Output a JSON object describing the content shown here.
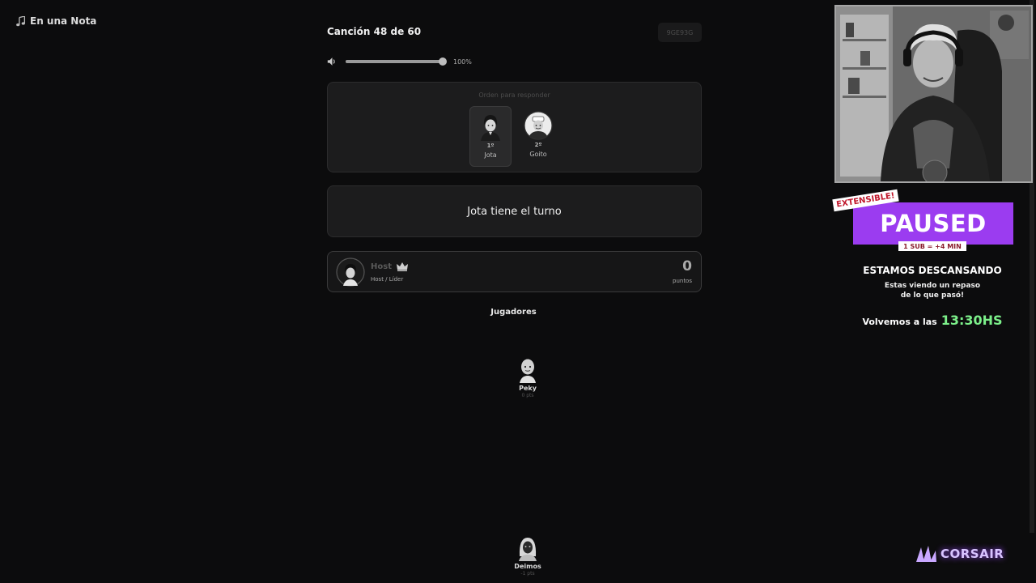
{
  "app": {
    "title": "En una Nota"
  },
  "game": {
    "song_counter": "Canción 48 de 60",
    "room_code": "9GE93G",
    "volume": {
      "percent": 100,
      "label": "100%"
    }
  },
  "order": {
    "title": "Orden para responder",
    "players": [
      {
        "position": "1º",
        "name": "Jota",
        "active": true,
        "avatar": "woman-avatar-icon"
      },
      {
        "position": "2º",
        "name": "Goito",
        "active": false,
        "avatar": "chef-avatar-icon"
      }
    ]
  },
  "turn": {
    "text": "Jota tiene el turno"
  },
  "host": {
    "name": "Host",
    "role": "Host / Líder",
    "score": "0",
    "score_label": "puntos",
    "icon": "crown-icon"
  },
  "players_section": {
    "label": "Jugadores",
    "players": [
      {
        "name": "Peky",
        "points": "0 pts",
        "avatar": "bald-avatar-icon"
      },
      {
        "name": "Deimos",
        "points": "-1 pts",
        "avatar": "hooded-avatar-icon"
      }
    ]
  },
  "stream_overlay": {
    "badge": "EXTENSIBLE!",
    "status": "PAUSED",
    "sub_info": "1 SUB = +4 MIN",
    "title": "ESTAMOS DESCANSANDO",
    "subtitle_line1": "Estas viendo un repaso",
    "subtitle_line2": "de lo que pasó!",
    "return_label": "Volvemos a las",
    "return_time": "13:30HS",
    "sponsor": "CORSAIR",
    "colors": {
      "paused_bg": "#9b3cf0",
      "time": "#7cf08a"
    }
  }
}
